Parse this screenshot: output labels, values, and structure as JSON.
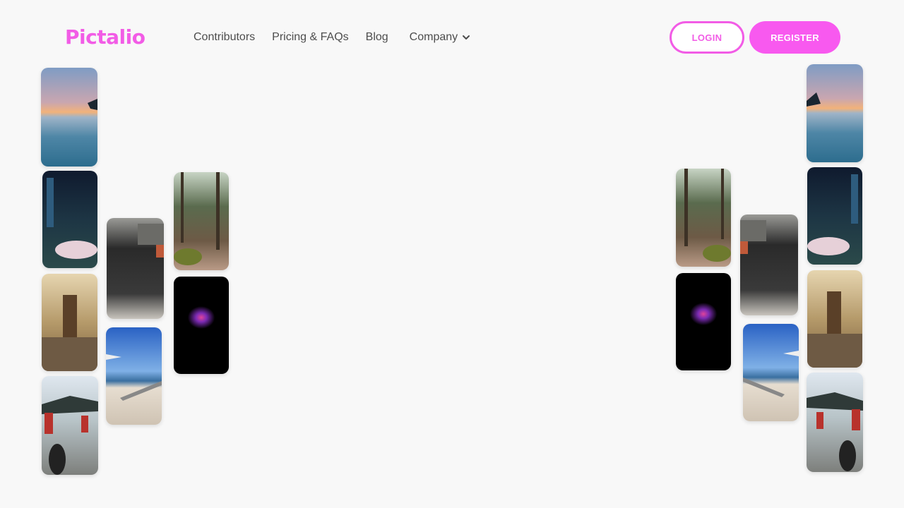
{
  "brand": {
    "name": "Pictalio",
    "color": "#f25ce6"
  },
  "nav": {
    "items": [
      {
        "label": "Contributors"
      },
      {
        "label": "Pricing & FAQs"
      },
      {
        "label": "Blog"
      },
      {
        "label": "Company",
        "icon": "chevron-down-icon"
      }
    ]
  },
  "auth": {
    "login_label": "LOGIN",
    "register_label": "REGISTER"
  },
  "colors": {
    "accent": "#f25ce6",
    "register_bg": "#f859ef",
    "page_bg": "#f8f8f8"
  },
  "gallery": {
    "photos": [
      "sunset-infinity-pool",
      "night-street",
      "ornate-hall-terrace",
      "temple-courtyard",
      "building-entrance",
      "beach-walkway",
      "forest-path",
      "glowing-tree-night"
    ]
  }
}
